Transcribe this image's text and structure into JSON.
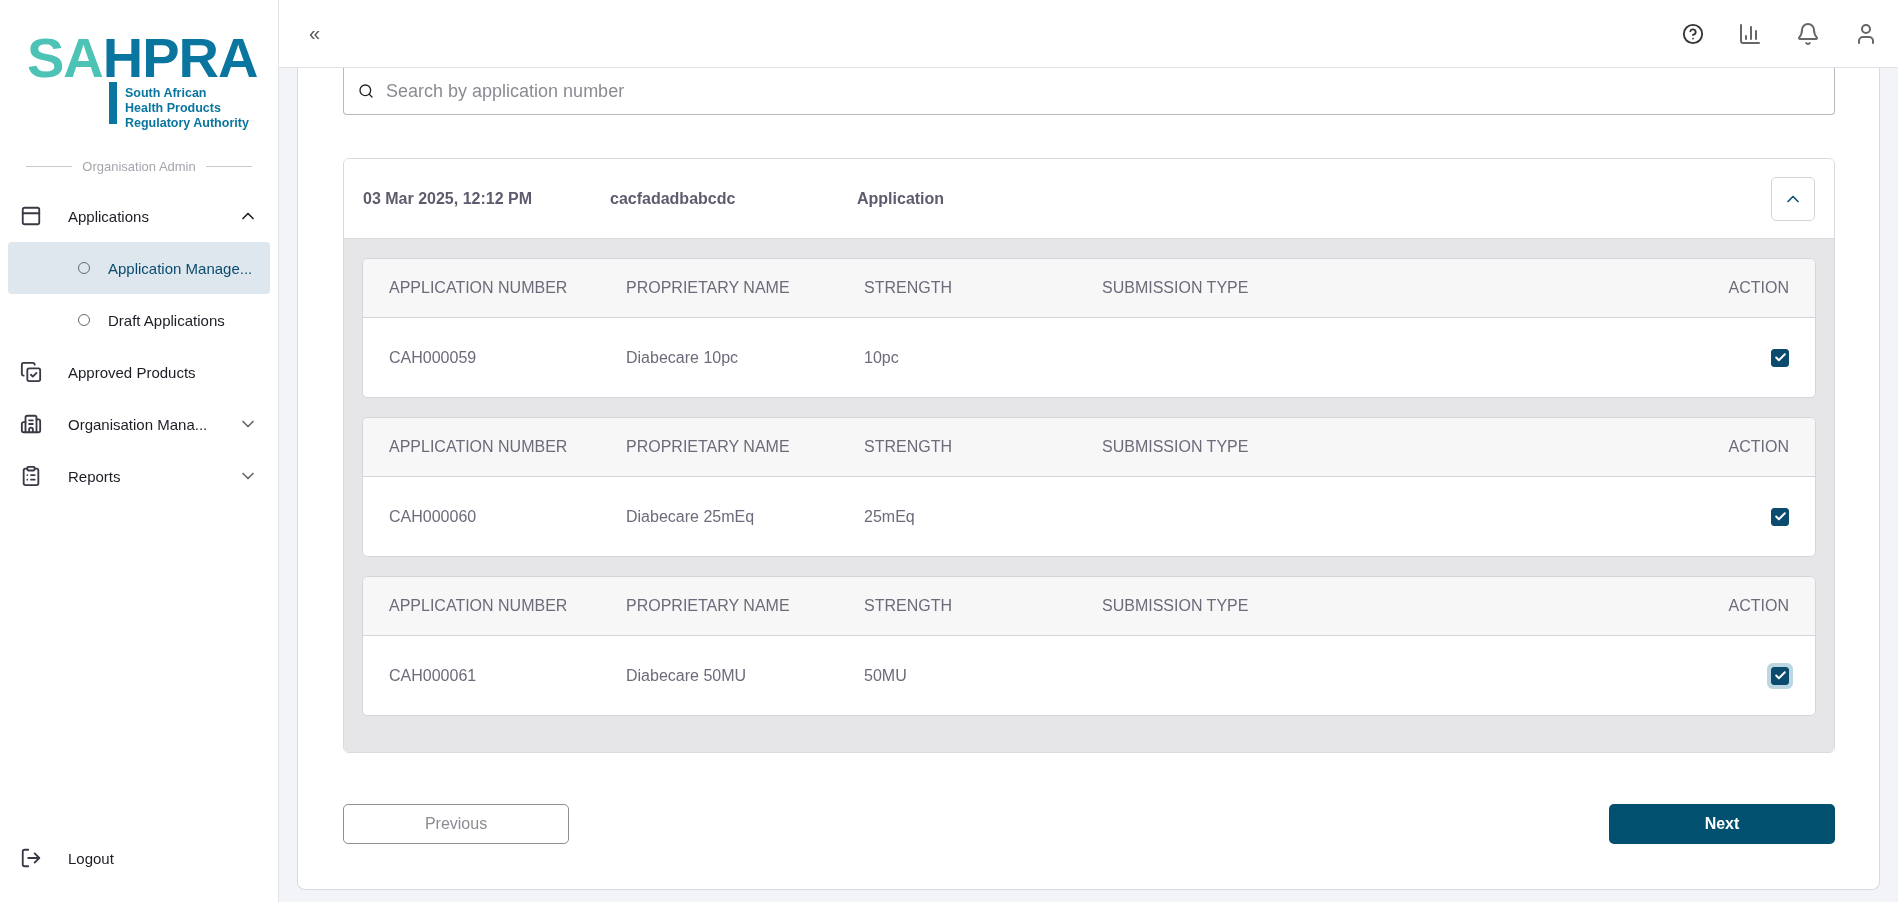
{
  "logo": {
    "mark_left": "SA",
    "mark_right": "HPRA",
    "tagline": "South African\nHealth Products\nRegulatory Authority"
  },
  "sidebar": {
    "section_label": "Organisation Admin",
    "items": [
      {
        "kind": "applications",
        "label": "Applications",
        "expanded": true,
        "children": [
          {
            "label": "Application Manage...",
            "selected": true
          },
          {
            "label": "Draft Applications",
            "selected": false
          }
        ]
      },
      {
        "kind": "approved",
        "label": "Approved Products"
      },
      {
        "kind": "organisation",
        "label": "Organisation Mana...",
        "expanded": false
      },
      {
        "kind": "reports",
        "label": "Reports",
        "expanded": false
      }
    ],
    "logout": "Logout"
  },
  "header": {
    "collapse": "«"
  },
  "search": {
    "placeholder": "Search by application number"
  },
  "group": {
    "date": "03 Mar 2025, 12:12 PM",
    "reference": "cacfadadbabcdc",
    "type": "Application",
    "expanded": true,
    "tables": [
      {
        "columns": [
          "APPLICATION NUMBER",
          "PROPRIETARY NAME",
          "STRENGTH",
          "SUBMISSION TYPE",
          "ACTION"
        ],
        "application_number": "CAH000059",
        "proprietary_name": "Diabecare 10pc",
        "strength": "10pc",
        "checked": true,
        "focused": false
      },
      {
        "columns": [
          "APPLICATION NUMBER",
          "PROPRIETARY NAME",
          "STRENGTH",
          "SUBMISSION TYPE",
          "ACTION"
        ],
        "application_number": "CAH000060",
        "proprietary_name": "Diabecare 25mEq",
        "strength": "25mEq",
        "checked": true,
        "focused": false
      },
      {
        "columns": [
          "APPLICATION NUMBER",
          "PROPRIETARY NAME",
          "STRENGTH",
          "SUBMISSION TYPE",
          "ACTION"
        ],
        "application_number": "CAH000061",
        "proprietary_name": "Diabecare 50MU",
        "strength": "50MU",
        "checked": true,
        "focused": true
      }
    ]
  },
  "buttons": {
    "previous": "Previous",
    "next": "Next",
    "previous_disabled": true
  }
}
